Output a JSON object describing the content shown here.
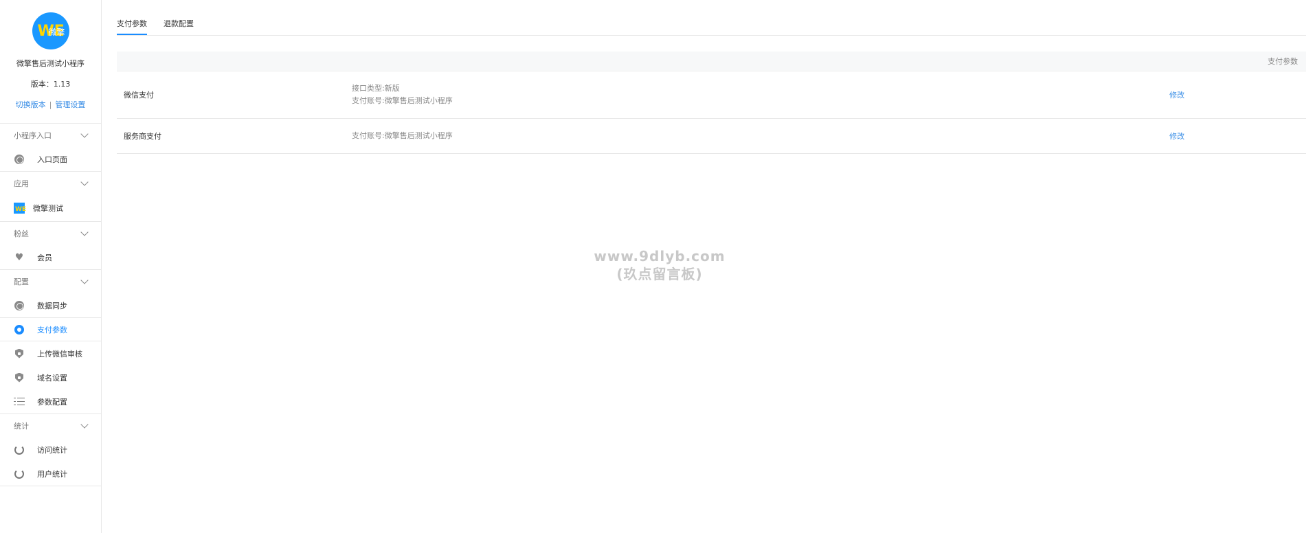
{
  "sidebar": {
    "brand": {
      "logo_text": "WE",
      "logo_cn": "微擎",
      "app_name": "微擎售后测试小程序",
      "version": "版本：1.13",
      "switch_version": "切换版本",
      "separator": "|",
      "manage_settings": "管理设置"
    },
    "groups": [
      {
        "title": "小程序入口",
        "items": [
          {
            "label": "入口页面",
            "icon": "link-icon"
          }
        ]
      },
      {
        "title": "应用",
        "items": [
          {
            "label": "微擎测试",
            "icon": "app-logo-icon"
          }
        ]
      },
      {
        "title": "粉丝",
        "items": [
          {
            "label": "会员",
            "icon": "heart-icon"
          }
        ]
      },
      {
        "title": "配置",
        "items": [
          {
            "label": "数据同步",
            "icon": "link-icon"
          },
          {
            "label": "支付参数",
            "icon": "gear-icon"
          },
          {
            "label": "上传微信审核",
            "icon": "shield-icon"
          },
          {
            "label": "域名设置",
            "icon": "shield-icon"
          },
          {
            "label": "参数配置",
            "icon": "list-icon"
          }
        ]
      },
      {
        "title": "统计",
        "items": [
          {
            "label": "访问统计",
            "icon": "rotate-icon"
          },
          {
            "label": "用户统计",
            "icon": "rotate-icon"
          }
        ]
      }
    ]
  },
  "tabs": [
    {
      "label": "支付参数"
    },
    {
      "label": "退款配置"
    }
  ],
  "table": {
    "header": "支付参数",
    "rows": [
      {
        "name": "微信支付",
        "info": [
          "接口类型:新版",
          "支付账号:微擎售后测试小程序"
        ],
        "action": "修改"
      },
      {
        "name": "服务商支付",
        "info": [
          "支付账号:微擎售后测试小程序"
        ],
        "action": "修改"
      }
    ]
  },
  "watermark": {
    "line1": "www.9dlyb.com",
    "line2": "(玖点留言板)"
  },
  "colors": {
    "accent": "#1a8cff",
    "link": "#3a8ee6",
    "border": "#e8e8e8",
    "table_header_bg": "#f7f8f9"
  }
}
